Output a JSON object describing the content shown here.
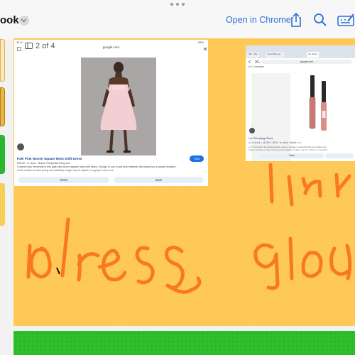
{
  "toolbar": {
    "notebook_title": "ook 7",
    "open_in_chrome": "Open in Chrome"
  },
  "page_indicator": {
    "label": "2 of 4"
  },
  "screenshot_dress": {
    "status_time": "12:40",
    "status_battery": "81%",
    "url": "google.com",
    "product_title": "Pale Pink Woven Square Neck Shift Dress",
    "price_line": "£35.00 · In stock · Brand: PrettyLittleThing.com",
    "description": "Channel your femininity in this pale pink woven square neck shift dress. Enough to you in soft pink material, this dress has a square neckline...",
    "disclaimer": "Check website for latest pricing and availability. Images may be subject to copyright. Learn more",
    "visit_label": "Visit",
    "share_label": "Share",
    "save_label": "Save"
  },
  "screenshot_lipgloss": {
    "tab1": "Tab · Top",
    "tab2": "ColourPop Lip...",
    "tab3": "Lip Gloss",
    "address": "google.com",
    "site_label": "e.l.f. Cosmetics",
    "product_title": "Lip Plumping Gloss",
    "rating": "4.4 ★★★★☆ (18.5K) · £8.00 · In stock · Brand: e.l.f.",
    "desc1": "e.l.f. Cosmetics' lip plumping gloss gives a plumper, moisturized lip for a fuller pout.",
    "desc2": "Check website for latest pricing and availability. Images may be subject to copyright.",
    "save_label": "Save"
  },
  "colors": {
    "page_background": "#fec957",
    "ink": "#f97a1c",
    "accent_blue": "#2d6fd8",
    "next_page_green": "#2fbf2a"
  }
}
